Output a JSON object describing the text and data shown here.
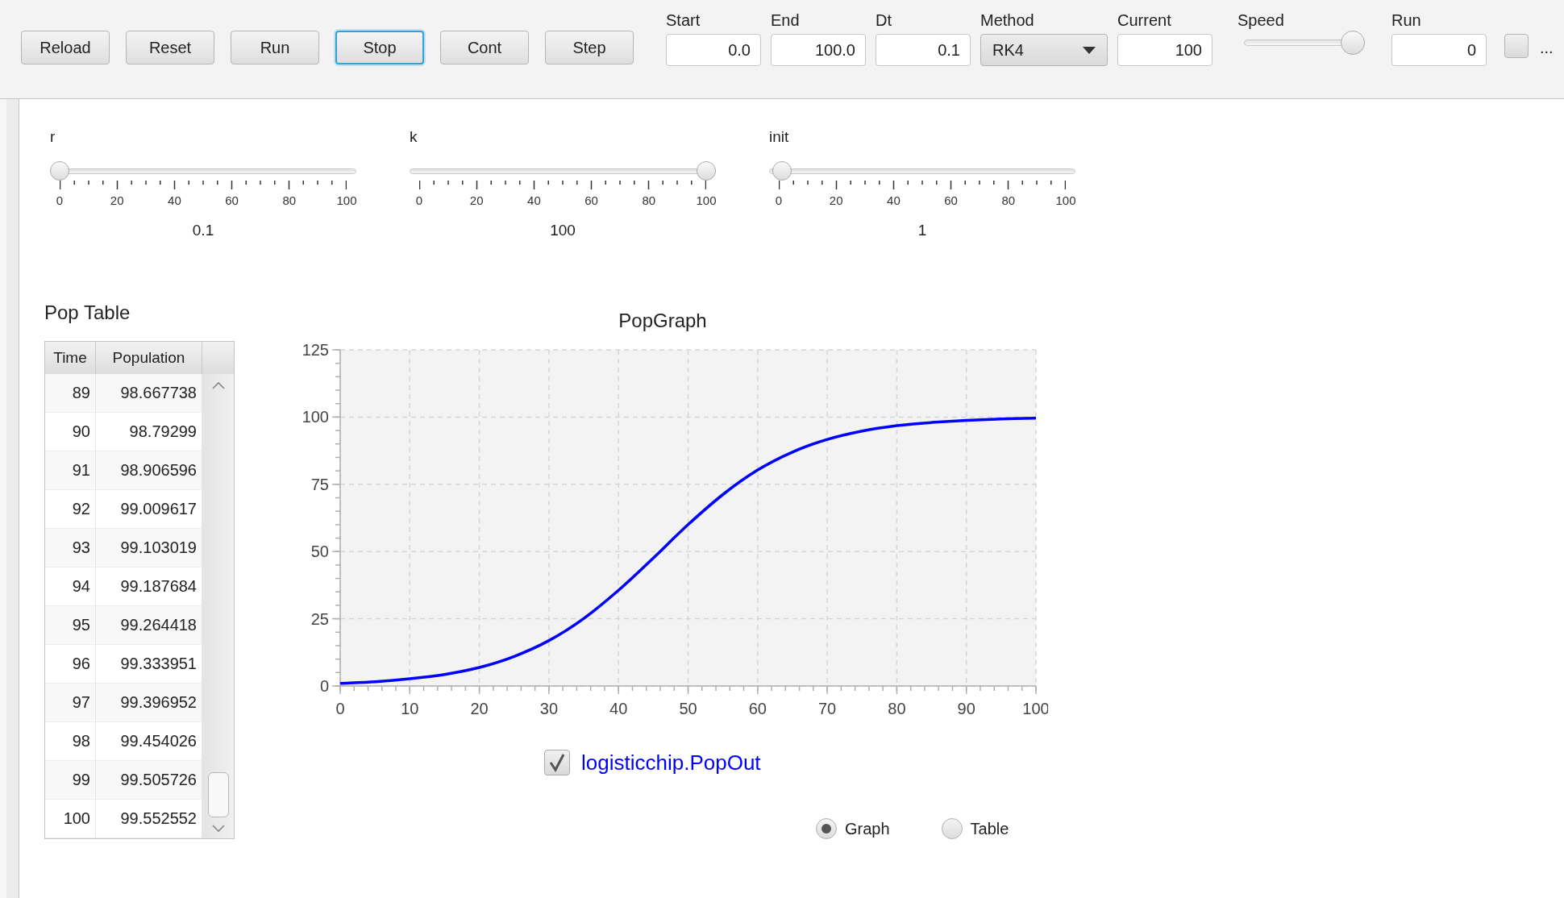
{
  "toolbar": {
    "buttons": [
      {
        "label": "Reload",
        "focused": false
      },
      {
        "label": "Reset",
        "focused": false
      },
      {
        "label": "Run",
        "focused": false
      },
      {
        "label": "Stop",
        "focused": true
      },
      {
        "label": "Cont",
        "focused": false
      },
      {
        "label": "Step",
        "focused": false
      }
    ],
    "controls": [
      {
        "kind": "field",
        "label": "Start",
        "value": "0.0"
      },
      {
        "kind": "field",
        "label": "End",
        "value": "100.0"
      },
      {
        "kind": "field",
        "label": "Dt",
        "value": "0.1"
      },
      {
        "kind": "dropdown",
        "label": "Method",
        "value": "RK4"
      },
      {
        "kind": "field",
        "label": "Current",
        "value": "100"
      },
      {
        "kind": "slider",
        "label": "Speed",
        "level": 1
      },
      {
        "kind": "field",
        "label": "Run",
        "value": "0"
      }
    ],
    "toggle": {
      "checked": false
    },
    "more": "..."
  },
  "sliders": [
    {
      "label": "r",
      "level": 0.001,
      "ticks": [
        "0",
        "20",
        "40",
        "60",
        "80",
        "100"
      ],
      "value": "0.1"
    },
    {
      "label": "k",
      "level": 1,
      "ticks": [
        "0",
        "20",
        "40",
        "60",
        "80",
        "100"
      ],
      "value": "100"
    },
    {
      "label": "init",
      "level": 0.01,
      "ticks": [
        "0",
        "20",
        "40",
        "60",
        "80",
        "100"
      ],
      "value": "1"
    }
  ],
  "table": {
    "title": "Pop Table",
    "columns": [
      "Time",
      "Population"
    ],
    "rows": [
      [
        "89",
        "98.667738"
      ],
      [
        "90",
        "98.79299"
      ],
      [
        "91",
        "98.906596"
      ],
      [
        "92",
        "99.009617"
      ],
      [
        "93",
        "99.103019"
      ],
      [
        "94",
        "99.187684"
      ],
      [
        "95",
        "99.264418"
      ],
      [
        "96",
        "99.333951"
      ],
      [
        "97",
        "99.396952"
      ],
      [
        "98",
        "99.454026"
      ],
      [
        "99",
        "99.505726"
      ],
      [
        "100",
        "99.552552"
      ]
    ]
  },
  "graph": {
    "chart_data": {
      "type": "line",
      "title": "PopGraph",
      "x": [
        0,
        5,
        10,
        15,
        20,
        25,
        30,
        35,
        40,
        45,
        50,
        55,
        60,
        65,
        70,
        75,
        80,
        85,
        90,
        95,
        100
      ],
      "series": [
        {
          "name": "logisticchip.PopOut",
          "color": "#0000ff",
          "values": [
            1.0,
            1.6,
            2.7,
            4.3,
            6.9,
            11.0,
            16.9,
            25.1,
            35.6,
            47.6,
            60.0,
            71.2,
            80.3,
            87.0,
            91.7,
            94.8,
            96.8,
            98.0,
            98.8,
            99.3,
            99.6
          ]
        }
      ],
      "xlim": [
        0,
        100
      ],
      "ylim": [
        0,
        125
      ],
      "xticks": [
        0,
        10,
        20,
        30,
        40,
        50,
        60,
        70,
        80,
        90,
        100
      ],
      "yticks": [
        0,
        25,
        50,
        75,
        100,
        125
      ],
      "grid": true
    },
    "legend": {
      "checked": true
    },
    "view_options": [
      {
        "label": "Graph",
        "selected": true
      },
      {
        "label": "Table",
        "selected": false
      }
    ]
  }
}
